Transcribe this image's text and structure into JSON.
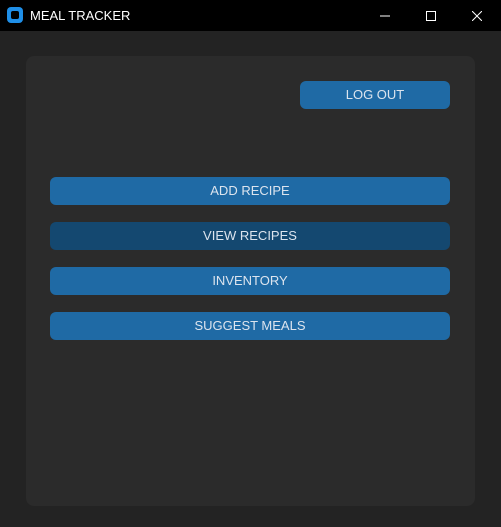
{
  "window": {
    "title": "MEAL TRACKER",
    "icons": {
      "app": "app-icon",
      "minimize": "minimize-icon",
      "maximize": "maximize-icon",
      "close": "close-icon"
    }
  },
  "panel": {
    "logout_label": "LOG OUT",
    "menu": [
      {
        "label": "ADD RECIPE"
      },
      {
        "label": "VIEW RECIPES"
      },
      {
        "label": "INVENTORY"
      },
      {
        "label": "SUGGEST MEALS"
      }
    ]
  },
  "colors": {
    "accent": "#1f6aa5",
    "accent_hover": "#144870",
    "panel_bg": "#2b2b2b",
    "window_bg": "#232323",
    "titlebar_bg": "#000000",
    "button_text": "#dce4ee"
  }
}
